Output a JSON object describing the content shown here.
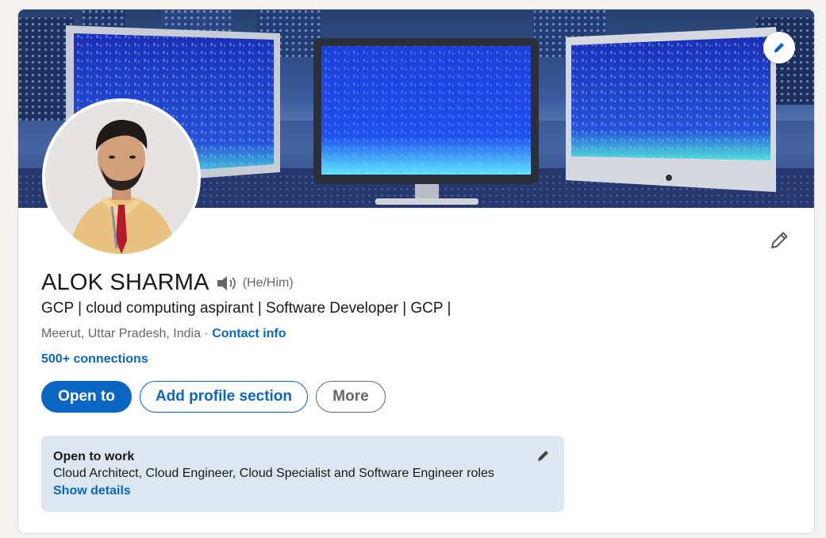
{
  "profile": {
    "name": "ALOK SHARMA",
    "pronouns": "(He/Him)",
    "headline": "GCP | cloud computing aspirant | Software Developer | GCP |",
    "location": "Meerut, Uttar Pradesh, India",
    "separator": " · ",
    "contact_info_label": "Contact info",
    "connections_label": "500+ connections"
  },
  "actions": {
    "open_to_label": "Open to",
    "add_section_label": "Add profile section",
    "more_label": "More"
  },
  "open_to_work": {
    "title": "Open to work",
    "roles": "Cloud Architect, Cloud Engineer, Cloud Specialist and Software Engineer roles",
    "show_details_label": "Show details"
  },
  "icons": {
    "cover_edit": "pencil-icon",
    "intro_edit": "pencil-icon",
    "name_pronunciation": "speaker-icon",
    "open_to_work_edit": "pencil-icon"
  },
  "colors": {
    "accent": "#0a66c2",
    "page_background": "#f3f2ef",
    "open_to_work_background": "#dde7f1",
    "secondary_text": "#666666"
  }
}
